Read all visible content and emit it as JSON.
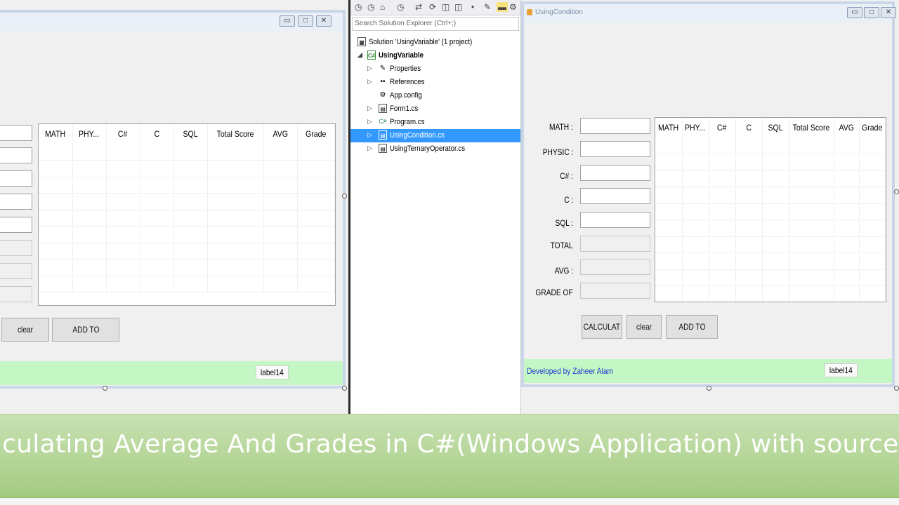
{
  "left_window": {
    "buttons": {
      "clear": "clear",
      "add": "ADD TO"
    },
    "grid_headers": [
      "MATH",
      "PHY...",
      "C#",
      "C",
      "SQL",
      "Total Score",
      "AVG",
      "Grade"
    ],
    "status_label": "label14"
  },
  "solution_explorer": {
    "search_placeholder": "Search Solution Explorer (Ctrl+;)",
    "items": [
      {
        "label": "Solution 'UsingVariable' (1 project)"
      },
      {
        "label": "UsingVariable"
      },
      {
        "label": "Properties"
      },
      {
        "label": "References"
      },
      {
        "label": "App.config"
      },
      {
        "label": "Form1.cs"
      },
      {
        "label": "Program.cs"
      },
      {
        "label": "UsingCondition.cs"
      },
      {
        "label": "UsingTernaryOperator.cs"
      }
    ]
  },
  "right_window": {
    "title": "UsingCondition",
    "labels": [
      "MATH :",
      "PHYSIC :",
      "C# :",
      "C :",
      "SQL :",
      "TOTAL",
      "AVG :",
      "GRADE OF"
    ],
    "grid_headers": [
      "MATH",
      "PHY...",
      "C#",
      "C",
      "SQL",
      "Total Score",
      "AVG",
      "Grade"
    ],
    "buttons": {
      "calculate": "CALCULAT",
      "clear": "clear",
      "add": "ADD TO"
    },
    "developer": "Developed by Zaheer Alam",
    "status_label": "label14",
    "selected_color": "#3399ff",
    "status_color": "#c4f7c4"
  },
  "banner": {
    "text": "Calculating Average And Grades in C#(Windows Application) with source code"
  }
}
